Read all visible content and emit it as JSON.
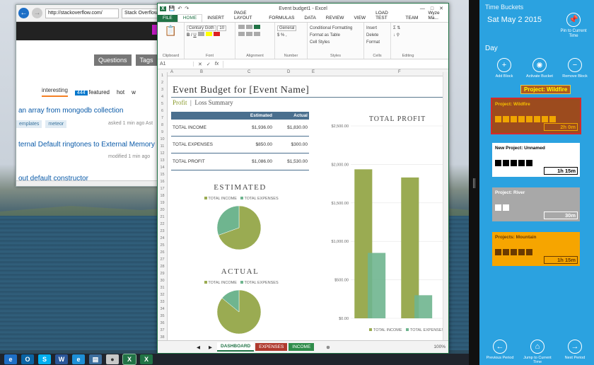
{
  "ie": {
    "address": "http://stackoverflow.com/",
    "tab_label": "Stack Overflow",
    "nav_buttons": [
      "Questions",
      "Tags"
    ],
    "tabs": [
      {
        "label": "interesting",
        "active": true
      },
      {
        "label": "featured",
        "badge": "444"
      },
      {
        "label": "hot"
      },
      {
        "label": "w"
      }
    ],
    "questions": [
      {
        "title": "an array from mongodb collection",
        "tags": [
          "emplates",
          "meteor"
        ],
        "meta": "asked 1 min ago Ast"
      },
      {
        "title": "ternal Default ringtones to External Memory",
        "meta": "modified 1 min ago"
      },
      {
        "title": "out default constructor"
      }
    ]
  },
  "excel": {
    "window_title": "Event budget1 - Excel",
    "user": "Wyze Ma...",
    "ribbon_tabs": [
      "FILE",
      "HOME",
      "INSERT",
      "PAGE LAYOUT",
      "FORMULAS",
      "DATA",
      "REVIEW",
      "VIEW",
      "LOAD TEST",
      "TEAM"
    ],
    "ribbon": {
      "font_name": "Century Goth",
      "font_size": "10",
      "number_format": "General",
      "styles": [
        "Conditional Formatting",
        "Format as Table",
        "Cell Styles"
      ],
      "cells": [
        "Insert",
        "Delete",
        "Format"
      ],
      "groups": [
        "Clipboard",
        "Font",
        "Alignment",
        "Number",
        "Styles",
        "Cells",
        "Editing"
      ]
    },
    "cell_ref": "A1",
    "fx": "fx",
    "columns": [
      "A",
      "B",
      "C",
      "D",
      "E",
      "F"
    ],
    "doc_title": "Event Budget for [Event Name]",
    "subtitle_a": "Profit",
    "subtitle_b": "Loss Summary",
    "table": {
      "headers": [
        "",
        "Estimated",
        "Actual"
      ],
      "rows": [
        {
          "label": "TOTAL INCOME",
          "estimated": "$1,936.00",
          "actual": "$1,830.00"
        },
        {
          "label": "TOTAL EXPENSES",
          "estimated": "$850.00",
          "actual": "$300.00"
        },
        {
          "label": "TOTAL PROFIT",
          "estimated": "$1,086.00",
          "actual": "$1,530.00"
        }
      ]
    },
    "pie_estimated_title": "ESTIMATED",
    "pie_actual_title": "ACTUAL",
    "legend": {
      "income": "TOTAL INCOME",
      "expenses": "TOTAL EXPENSES"
    },
    "sheet_tabs": [
      "DASHBOARD",
      "EXPENSES",
      "INCOME"
    ],
    "zoom": "100%"
  },
  "chart_data": [
    {
      "type": "pie",
      "title": "ESTIMATED",
      "categories": [
        "TOTAL INCOME",
        "TOTAL EXPENSES"
      ],
      "values": [
        1936,
        850
      ]
    },
    {
      "type": "pie",
      "title": "ACTUAL",
      "categories": [
        "TOTAL INCOME",
        "TOTAL EXPENSES"
      ],
      "values": [
        1830,
        300
      ]
    },
    {
      "type": "bar",
      "title": "TOTAL PROFIT",
      "categories": [
        "Estimated",
        "Actual"
      ],
      "series": [
        {
          "name": "TOTAL INCOME",
          "values": [
            1936,
            1830
          ]
        },
        {
          "name": "TOTAL EXPENSES",
          "values": [
            850,
            300
          ]
        }
      ],
      "yticks": [
        "$0.00",
        "$500.00",
        "$1,000.00",
        "$1,500.00",
        "$2,000.00",
        "$2,500.00"
      ],
      "ylim": [
        0,
        2500
      ],
      "colors": {
        "income": "#9aab52",
        "expenses": "#6fb58f"
      }
    }
  ],
  "timebuckets": {
    "app_title": "Time Buckets",
    "date": "Sat May 2 2015",
    "pin_label": "Pin to Current Time",
    "day_label": "Day",
    "actions": [
      "Add Block",
      "Activate Bucket",
      "Remove Block"
    ],
    "selected_label": "Project: Wildfire",
    "buckets": [
      {
        "name": "Project: Wildfire",
        "duration": "2h 0m",
        "blocks": 8,
        "bg": "#9c4b1e",
        "fg": "#f0a500",
        "selected": true
      },
      {
        "name": "New Project: Unnamed",
        "duration": "1h 15m",
        "blocks": 5,
        "bg": "#ffffff",
        "fg": "#000000"
      },
      {
        "name": "Project: River",
        "duration": "30m",
        "blocks": 2,
        "bg": "#a8a8a8",
        "fg": "#ffffff"
      },
      {
        "name": "Projects: Mountain",
        "duration": "1h 15m",
        "blocks": 5,
        "bg": "#f6a500",
        "fg": "#6b3a00"
      }
    ],
    "bottom": [
      "Previous Period",
      "Jump to Current Time",
      "Next Period"
    ]
  },
  "taskbar": {
    "icons": [
      "ie-icon",
      "outlook-icon",
      "skype-icon",
      "word-icon",
      "ie2-icon",
      "files-icon",
      "paint-icon",
      "excel-window-icon",
      "excel-icon"
    ]
  }
}
